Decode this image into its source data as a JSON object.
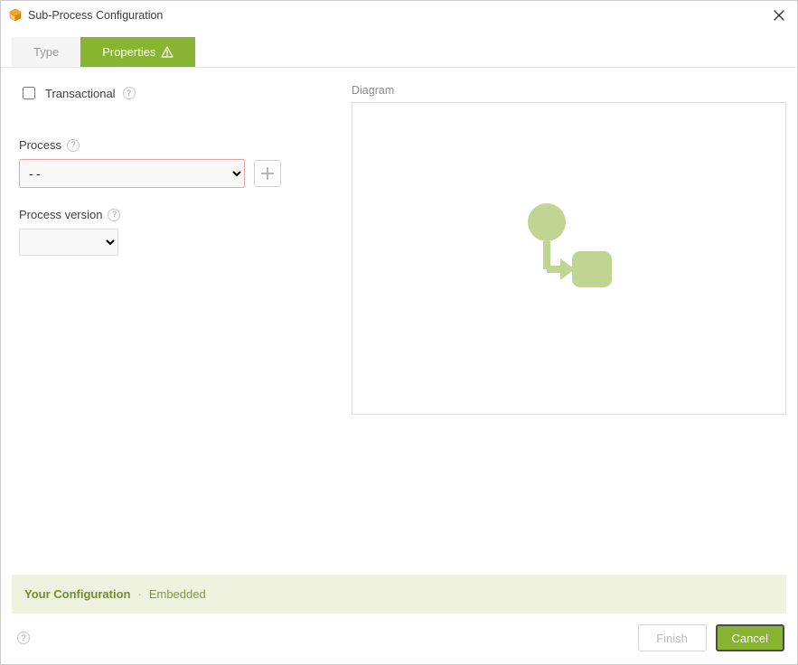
{
  "dialog": {
    "title": "Sub-Process Configuration"
  },
  "tabs": {
    "type": "Type",
    "properties": "Properties"
  },
  "form": {
    "transactional_label": "Transactional",
    "transactional_checked": false,
    "process_label": "Process",
    "process_selected": "- -",
    "process_options": [
      "- -"
    ],
    "process_version_label": "Process version",
    "process_version_selected": ""
  },
  "diagram": {
    "label": "Diagram"
  },
  "summary": {
    "label": "Your Configuration",
    "value": "Embedded"
  },
  "footer": {
    "finish": "Finish",
    "cancel": "Cancel"
  }
}
